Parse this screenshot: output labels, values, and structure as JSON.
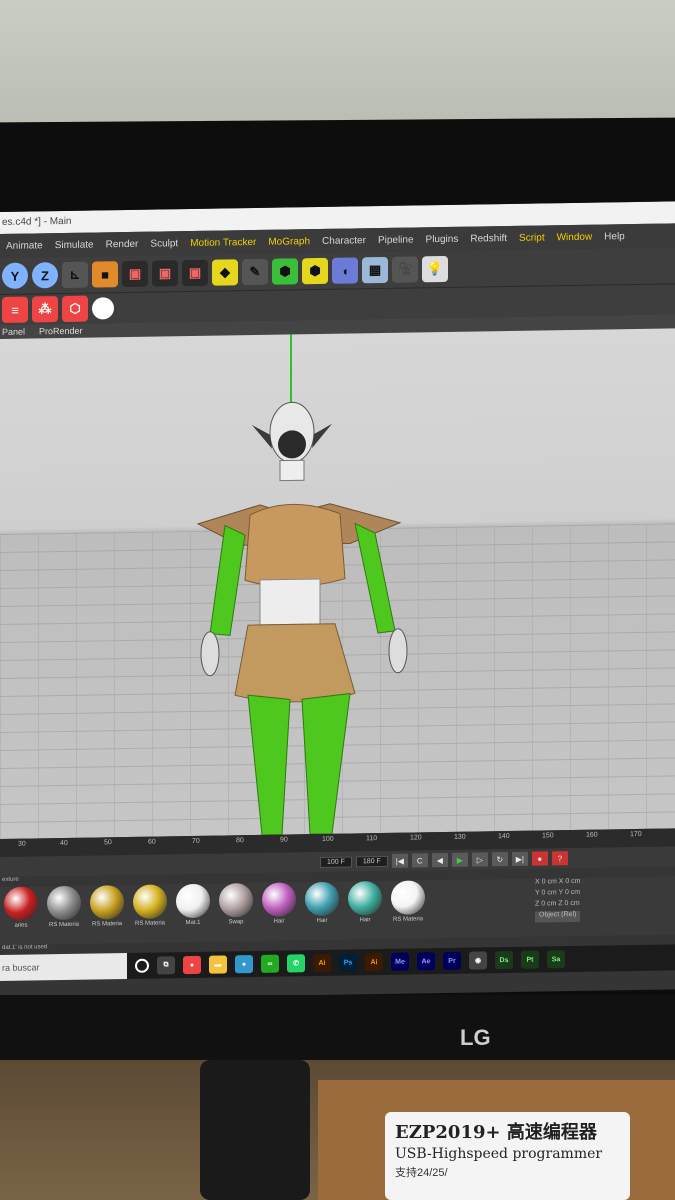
{
  "window": {
    "title": "es.c4d *] - Main"
  },
  "menu": [
    "Animate",
    "Simulate",
    "Render",
    "Sculpt",
    "Motion Tracker",
    "MoGraph",
    "Character",
    "Pipeline",
    "Plugins",
    "Redshift",
    "Script",
    "Window",
    "Help"
  ],
  "menu_highlighted": [
    "Motion Tracker",
    "MoGraph",
    "Script",
    "Window"
  ],
  "toolbar": {
    "axis_labels": [
      "Y",
      "Z"
    ]
  },
  "panelbar": {
    "items": [
      "Panel",
      "ProRender"
    ]
  },
  "ruler": {
    "ticks": [
      "30",
      "40",
      "50",
      "60",
      "70",
      "80",
      "90",
      "100",
      "110",
      "120",
      "130",
      "140",
      "150",
      "160",
      "170"
    ]
  },
  "timeline": {
    "field_a": "100 F",
    "field_b": "180 F"
  },
  "materials": {
    "label": "exture",
    "items": [
      {
        "name": "aries",
        "color": "#c82020"
      },
      {
        "name": "RS Materia",
        "color": "#8c8c8c"
      },
      {
        "name": "RS Materia",
        "color": "#c8a020"
      },
      {
        "name": "RS Materia",
        "color": "#d4b020"
      },
      {
        "name": "Mat.1",
        "color": "#f0f0f0"
      },
      {
        "name": "Swap",
        "color": "#b0a0a0"
      },
      {
        "name": "Hair",
        "color": "#c060c0"
      },
      {
        "name": "Hair",
        "color": "#40a0b0"
      },
      {
        "name": "Hair",
        "color": "#40b0a0"
      },
      {
        "name": "RS Materia",
        "color": "#f4f4f4"
      }
    ],
    "status": "dat.1' is not used"
  },
  "coords": {
    "rows": [
      "X  0 cm    X  0 cm",
      "Y  0 cm    Y  0 cm",
      "Z  0 cm    Z  0 cm"
    ],
    "mode": "Object (Rel)"
  },
  "taskbar": {
    "search": "ra buscar",
    "apps": [
      "Ai",
      "Ps",
      "Ai",
      "Me",
      "Ae",
      "Pr",
      "Ds",
      "Pt",
      "Sa"
    ]
  },
  "monitor": {
    "brand": "LG"
  },
  "sticker": {
    "line1": "EZP2019+ 高速编程器",
    "line2": "USB-Highspeed programmer",
    "line3": "支持24/25/"
  }
}
